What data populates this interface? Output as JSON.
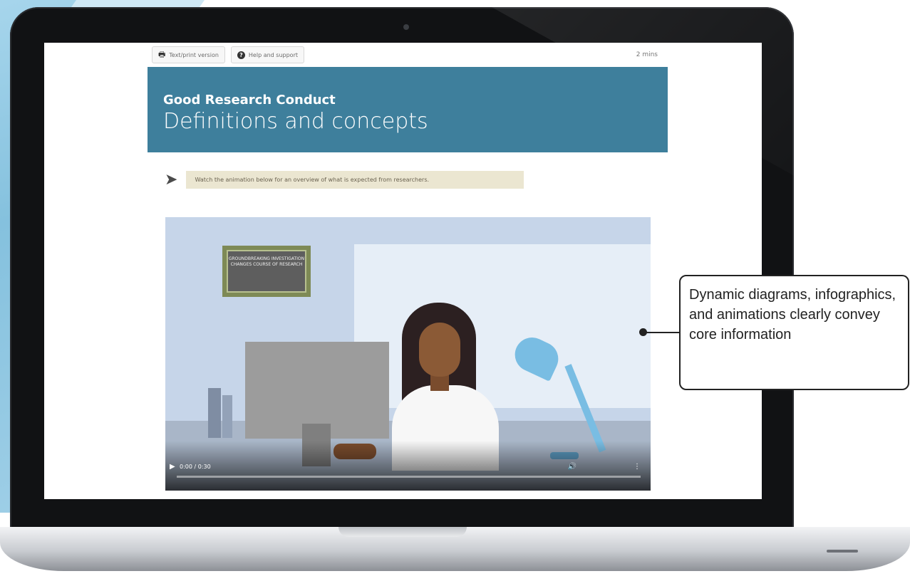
{
  "toolbar": {
    "text_print_label": "Text/print version",
    "help_label": "Help and support",
    "duration": "2 mins"
  },
  "banner": {
    "course_title": "Good Research Conduct",
    "page_title": "Definitions and concepts"
  },
  "instruction": {
    "text": "Watch the animation below for an overview of what is expected from researchers."
  },
  "video": {
    "sign_text": "GROUNDBREAKING INVESTIGATION CHANGES COURSE OF RESEARCH",
    "time": "0:00 / 0:30",
    "progress": 0
  },
  "callout": {
    "text": "Dynamic diagrams, infographics, and animations clearly convey core information"
  },
  "colors": {
    "banner": "#3e7f9c",
    "instruction_bg": "#ebe6d1",
    "laptop_bezel": "#111214"
  }
}
